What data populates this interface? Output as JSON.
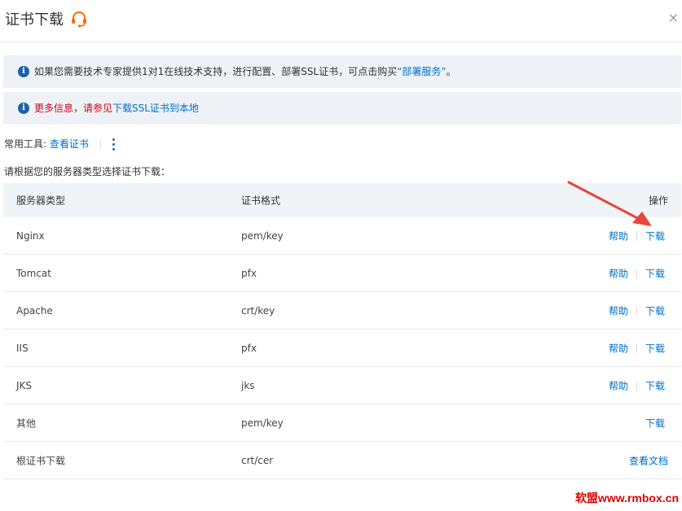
{
  "header": {
    "title": "证书下载",
    "close_label": "×",
    "support_icon": "headset-icon"
  },
  "notices": [
    {
      "text_before": "如果您需要技术专家提供1对1在线技术支持，进行配置、部署SSL证书，可点击购买",
      "link": "“部署服务”",
      "text_after": "。",
      "icon": "info-icon"
    },
    {
      "text_before": "更多信息，请参见",
      "link": "下载SSL证书到本地",
      "text_after": "",
      "icon": "info-icon"
    }
  ],
  "tools": {
    "label": "常用工具:",
    "view_link": "查看证书",
    "more_icon": "more-vertical-icon"
  },
  "instruction": "请根据您的服务器类型选择证书下载：",
  "table": {
    "headers": {
      "server": "服务器类型",
      "format": "证书格式",
      "action": "操作"
    },
    "rows": [
      {
        "server": "Nginx",
        "format": "pem/key",
        "help": "帮助",
        "download": "下载"
      },
      {
        "server": "Tomcat",
        "format": "pfx",
        "help": "帮助",
        "download": "下载"
      },
      {
        "server": "Apache",
        "format": "crt/key",
        "help": "帮助",
        "download": "下载"
      },
      {
        "server": "IIS",
        "format": "pfx",
        "help": "帮助",
        "download": "下载"
      },
      {
        "server": "JKS",
        "format": "jks",
        "help": "帮助",
        "download": "下载"
      },
      {
        "server": "其他",
        "format": "pem/key",
        "help": "",
        "download": "下载"
      },
      {
        "server": "根证书下载",
        "format": "crt/cer",
        "help": "",
        "download": "查看文档"
      }
    ]
  },
  "watermark": "软盟www.rmbox.cn",
  "colors": {
    "link": "#0070cc",
    "notice_bg": "#eef2f6",
    "warning_text": "#d0021b",
    "accent_icon": "#ff6a00",
    "arrow": "#e8453c"
  }
}
